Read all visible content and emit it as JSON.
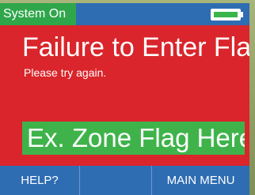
{
  "status_bar": {
    "status_text": "System On",
    "battery_icon": "battery-full-icon",
    "battery_level": 1.0
  },
  "message": {
    "title": "Failure to Enter Flag",
    "subtitle": "Please try again."
  },
  "zone_flag": {
    "text": "Ex. Zone Flag Here"
  },
  "soft_keys": {
    "left_label": "HELP?",
    "middle_label": "",
    "right_label": "MAIN MENU"
  },
  "colors": {
    "screen_background": "#d9252b",
    "bar_blue": "#2f6db3",
    "status_green": "#2fa64a",
    "flag_green": "#3fb34a",
    "text": "#ffffff"
  }
}
